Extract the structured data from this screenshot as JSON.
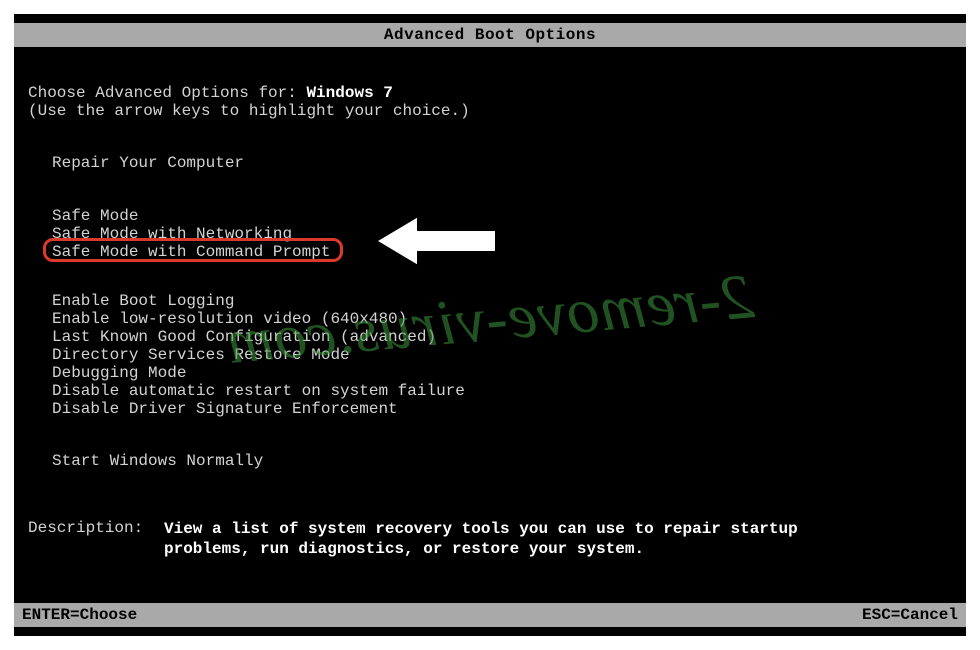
{
  "title": "Advanced Boot Options",
  "header": {
    "prompt": "Choose Advanced Options for: ",
    "os": "Windows 7",
    "hint": "(Use the arrow keys to highlight your choice.)"
  },
  "groups": {
    "group1": [
      "Repair Your Computer"
    ],
    "group2": [
      "Safe Mode",
      "Safe Mode with Networking",
      "Safe Mode with Command Prompt"
    ],
    "group3": [
      "Enable Boot Logging",
      "Enable low-resolution video (640x480)",
      "Last Known Good Configuration (advanced)",
      "Directory Services Restore Mode",
      "Debugging Mode",
      "Disable automatic restart on system failure",
      "Disable Driver Signature Enforcement"
    ],
    "group4": [
      "Start Windows Normally"
    ]
  },
  "highlighted": "Safe Mode with Command Prompt",
  "description": {
    "label": "Description:",
    "text": "View a list of system recovery tools you can use to repair startup problems, run diagnostics, or restore your system."
  },
  "footer": {
    "left": "ENTER=Choose",
    "right": "ESC=Cancel"
  },
  "watermark": "2-remove-virus.com"
}
